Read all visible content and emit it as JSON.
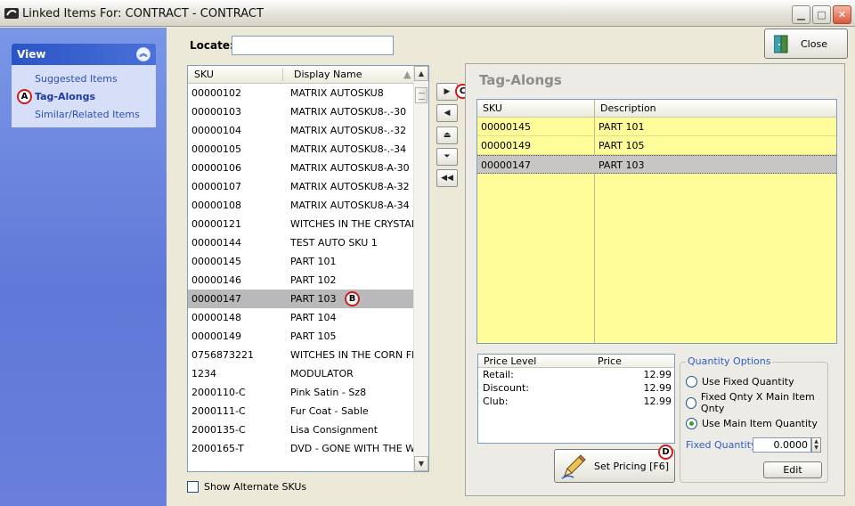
{
  "window": {
    "title": "Linked Items For: CONTRACT - CONTRACT"
  },
  "sidebar": {
    "header": "View",
    "items": [
      {
        "label": "Suggested Items"
      },
      {
        "label": "Tag-Alongs",
        "selected": true
      },
      {
        "label": "Similar/Related Items"
      }
    ]
  },
  "locate": {
    "label": "Locate:",
    "value": ""
  },
  "item_grid": {
    "columns": [
      "SKU",
      "Display Name"
    ],
    "rows": [
      {
        "sku": "00000102",
        "name": "MATRIX AUTOSKU8"
      },
      {
        "sku": "00000103",
        "name": "MATRIX AUTOSKU8-.-30"
      },
      {
        "sku": "00000104",
        "name": "MATRIX AUTOSKU8-.-32"
      },
      {
        "sku": "00000105",
        "name": "MATRIX AUTOSKU8-.-34"
      },
      {
        "sku": "00000106",
        "name": "MATRIX AUTOSKU8-A-30"
      },
      {
        "sku": "00000107",
        "name": "MATRIX AUTOSKU8-A-32"
      },
      {
        "sku": "00000108",
        "name": "MATRIX AUTOSKU8-A-34"
      },
      {
        "sku": "00000121",
        "name": "WITCHES IN THE CRYSTAL"
      },
      {
        "sku": "00000144",
        "name": "TEST AUTO SKU 1"
      },
      {
        "sku": "00000145",
        "name": "PART 101"
      },
      {
        "sku": "00000146",
        "name": "PART 102"
      },
      {
        "sku": "00000147",
        "name": "PART 103",
        "selected": true
      },
      {
        "sku": "00000148",
        "name": "PART 104"
      },
      {
        "sku": "00000149",
        "name": "PART 105"
      },
      {
        "sku": "0756873221",
        "name": "WITCHES IN THE CORN FIE"
      },
      {
        "sku": "1234",
        "name": "MODULATOR"
      },
      {
        "sku": "2000110-C",
        "name": "Pink Satin - Sz8"
      },
      {
        "sku": "2000111-C",
        "name": "Fur Coat - Sable"
      },
      {
        "sku": "2000135-C",
        "name": "Lisa Consignment"
      },
      {
        "sku": "2000165-T",
        "name": "DVD - GONE WITH THE WIN"
      }
    ]
  },
  "show_alternate_skus": {
    "label": "Show Alternate SKUs",
    "checked": false
  },
  "tag_alongs": {
    "title": "Tag-Alongs",
    "columns": [
      "SKU",
      "Description"
    ],
    "rows": [
      {
        "sku": "00000145",
        "description": "PART 101"
      },
      {
        "sku": "00000149",
        "description": "PART 105"
      },
      {
        "sku": "00000147",
        "description": "PART 103",
        "selected": true
      }
    ]
  },
  "price_levels": {
    "columns": [
      "Price Level",
      "Price"
    ],
    "rows": [
      {
        "level": "Retail:",
        "price": "12.99"
      },
      {
        "level": "Discount:",
        "price": "12.99"
      },
      {
        "level": "Club:",
        "price": "12.99"
      }
    ]
  },
  "set_pricing": {
    "label": "Set Pricing [F6]"
  },
  "quantity_options": {
    "legend": "Quantity Options",
    "options": [
      {
        "label": "Use Fixed Quantity",
        "selected": false
      },
      {
        "label": "Fixed Qnty X Main Item Qnty",
        "selected": false
      },
      {
        "label": "Use Main Item Quantity",
        "selected": true
      }
    ],
    "fixed_quantity_label": "Fixed Quantity:",
    "fixed_quantity_value": "0.0000",
    "edit_label": "Edit"
  },
  "close_button": {
    "label": "Close"
  },
  "callouts": {
    "a": "A",
    "b": "B",
    "c": "C",
    "d": "D"
  },
  "colors": {
    "tag_grid_bg": "#fefd9a",
    "selected_row": "#b9b9bb",
    "sidebar_blue": "#6a7fdc",
    "callout_red": "#d11c1c"
  }
}
